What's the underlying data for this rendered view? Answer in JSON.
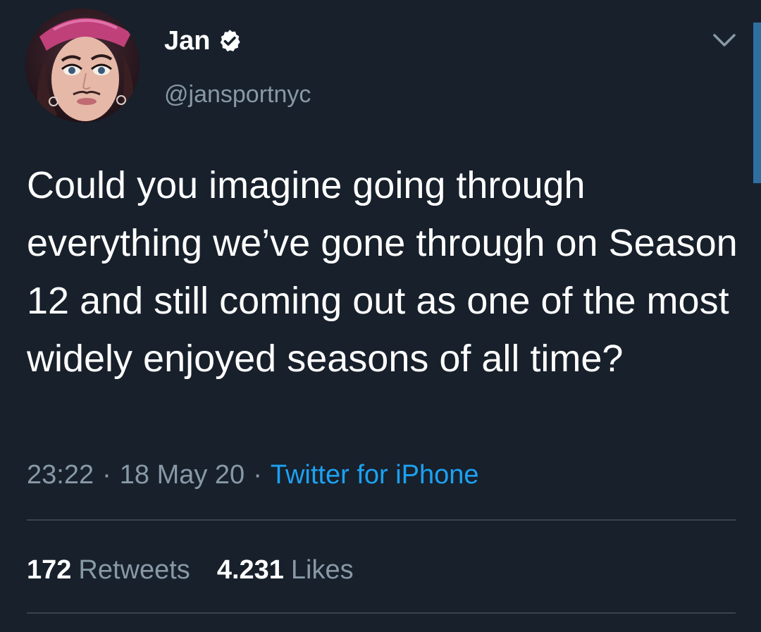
{
  "tweet": {
    "author": {
      "display_name": "Jan",
      "handle": "@jansportnyc",
      "verified": true,
      "avatar_icon": "profile-photo"
    },
    "text": "Could you imagine going through everything we’ve gone through on Season 12 and still coming out as one of the most widely enjoyed seasons of all time?",
    "time": "23:22",
    "date": "18 May 20",
    "separator": "·",
    "source": "Twitter for iPhone",
    "retweets": {
      "count": "172",
      "label": "Retweets"
    },
    "likes": {
      "count": "4.231",
      "label": "Likes"
    }
  },
  "icons": {
    "verified": "verified-badge-icon",
    "menu": "chevron-down-icon"
  },
  "colors": {
    "background": "#17202b",
    "secondary_text": "#8899a6",
    "accent": "#1da1f2",
    "divider": "#38444d"
  }
}
